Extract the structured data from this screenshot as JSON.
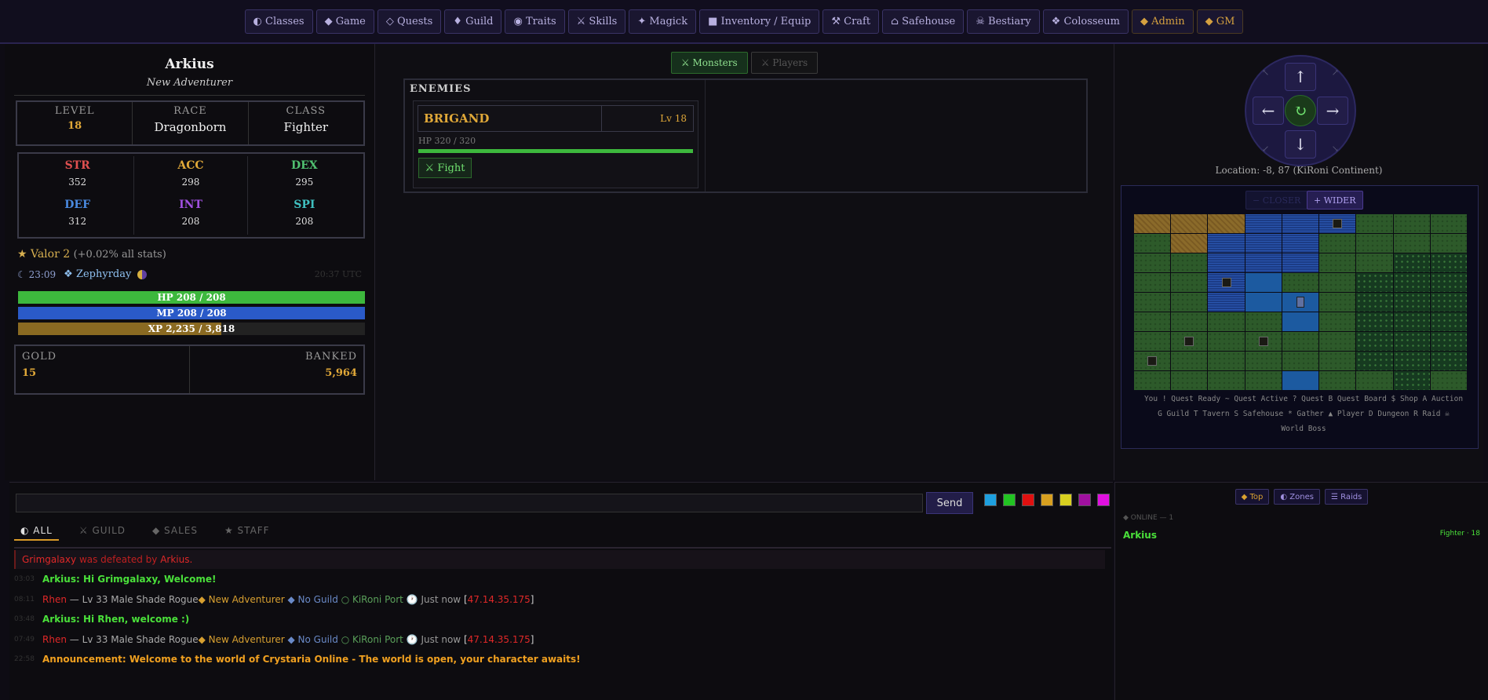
{
  "nav": {
    "items": [
      {
        "label": "◐ Classes",
        "color": "#b8b0e0"
      },
      {
        "label": "◆ Game",
        "color": "#b8b0e0"
      },
      {
        "label": "◇ Quests",
        "color": "#b8b0e0"
      },
      {
        "label": "♦ Guild",
        "color": "#b8b0e0"
      },
      {
        "label": "◉ Traits",
        "color": "#b8b0e0"
      },
      {
        "label": "⚔ Skills",
        "color": "#b8b0e0"
      },
      {
        "label": "✦ Magick",
        "color": "#b8b0e0"
      },
      {
        "label": "■ Inventory / Equip",
        "color": "#b8b0e0"
      },
      {
        "label": "⚒ Craft",
        "color": "#b8b0e0"
      },
      {
        "label": "⌂ Safehouse",
        "color": "#b8b0e0"
      },
      {
        "label": "☠ Bestiary",
        "color": "#b8b0e0"
      },
      {
        "label": "❖ Colosseum",
        "color": "#b8b0e0"
      },
      {
        "label": "◆ Admin",
        "color": "#d4a040"
      },
      {
        "label": "◆ GM",
        "color": "#d4a040"
      }
    ]
  },
  "character": {
    "name": "Arkius",
    "title": "New Adventurer",
    "level_label": "LEVEL",
    "level": "18",
    "race_label": "RACE",
    "race": "Dragonborn",
    "class_label": "CLASS",
    "class": "Fighter"
  },
  "stats": [
    {
      "name": "STR",
      "value": "352",
      "color": "#e05050"
    },
    {
      "name": "ACC",
      "value": "298",
      "color": "#e0a838"
    },
    {
      "name": "DEX",
      "value": "295",
      "color": "#50c070"
    },
    {
      "name": "DEF",
      "value": "312",
      "color": "#4a8ae0"
    },
    {
      "name": "INT",
      "value": "208",
      "color": "#a050e0"
    },
    {
      "name": "SPI",
      "value": "208",
      "color": "#40c0c0"
    }
  ],
  "valor": {
    "label": "★ Valor 2",
    "detail": "(+0.02% all stats)"
  },
  "time": {
    "game_time": "☾ 23:09",
    "day": "❖ Zephyrday",
    "utc": "20:37 UTC"
  },
  "bars": {
    "hp": {
      "text": "HP 208 / 208",
      "fraction": 1.0,
      "color": "#3db83d"
    },
    "mp": {
      "text": "MP 208 / 208",
      "fraction": 1.0,
      "color": "#2a5ac8"
    },
    "xp": {
      "text": "XP 2,235 / 3,818",
      "fraction": 0.585,
      "color": "#8a6a22"
    }
  },
  "gold": {
    "gold_label": "GOLD",
    "gold_value": "15",
    "banked_label": "BANKED",
    "banked_value": "5,964"
  },
  "combat": {
    "tab_monsters": "⚔ Monsters",
    "tab_players": "⚔ Players",
    "enemies_title": "ENEMIES",
    "enemy": {
      "name": "BRIGAND",
      "level": "Lv 18",
      "hp_text": "HP 320 / 320",
      "hp_fraction": 1.0,
      "fight_label": "⚔ Fight"
    }
  },
  "nav_pad": {
    "up": "↑",
    "down": "↓",
    "left": "←",
    "right": "→",
    "center": "↻",
    "ul": "↖",
    "ur": "↗",
    "dl": "↙",
    "dr": "↘"
  },
  "location": "Location: -8, 87 (KiRoni Continent)",
  "map": {
    "closer_label": "− CLOSER",
    "wider_label": "+ WIDER",
    "rows": [
      [
        "s",
        "s",
        "s",
        "w",
        "w",
        "w",
        "g",
        "g",
        "g"
      ],
      [
        "g",
        "s",
        "w",
        "w",
        "w",
        "g",
        "g",
        "g",
        "g"
      ],
      [
        "g",
        "g",
        "w",
        "w",
        "w",
        "g",
        "g",
        "f",
        "f"
      ],
      [
        "g",
        "g",
        "w",
        "d",
        "g",
        "g",
        "f",
        "f",
        "f"
      ],
      [
        "g",
        "g",
        "w",
        "d",
        "d",
        "g",
        "f",
        "f",
        "f"
      ],
      [
        "g",
        "g",
        "g",
        "g",
        "d",
        "g",
        "f",
        "f",
        "f"
      ],
      [
        "g",
        "g",
        "g",
        "g",
        "g",
        "g",
        "f",
        "f",
        "f"
      ],
      [
        "g",
        "g",
        "g",
        "g",
        "g",
        "g",
        "f",
        "f",
        "f"
      ],
      [
        "g",
        "g",
        "g",
        "g",
        "d",
        "g",
        "g",
        "f",
        "g"
      ]
    ],
    "legend_line1": "You ! Quest Ready ~ Quest Active ? Quest B Quest Board $ Shop A Auction",
    "legend_line2": "G Guild T Tavern S Safehouse * Gather ▲ Player D Dungeon R Raid ☠",
    "legend_line3": "World Boss"
  },
  "chat": {
    "input_placeholder": "",
    "send_label": "Send",
    "colors": [
      "#1ea0e0",
      "#22c422",
      "#e01010",
      "#d8a020",
      "#d8d020",
      "#a010a0",
      "#e010e0"
    ],
    "tabs": [
      "◐ ALL",
      "⚔ GUILD",
      "◆ SALES",
      "★ STAFF"
    ],
    "system": "Grimgalaxy was defeated by Arkius.",
    "lines": [
      {
        "time": "03:03",
        "text": "Arkius: Hi Grimgalaxy, Welcome!"
      },
      {
        "time": "08:11",
        "name": "Rhen",
        "detail": "— Lv 33 Male Shade Rogue",
        "title": "◆ New Adventurer",
        "guild": "◆ No Guild",
        "place": "○ KiRoni Port",
        "when": "🕐 Just now",
        "ip": "47.14.35.175"
      },
      {
        "time": "03:48",
        "text": "Arkius: Hi Rhen, welcome :)"
      },
      {
        "time": "07:49",
        "name": "Rhen",
        "detail": "— Lv 33 Male Shade Rogue",
        "title": "◆ New Adventurer",
        "guild": "◆ No Guild",
        "place": "○ KiRoni Port",
        "when": "🕐 Just now",
        "ip": "47.14.35.175"
      },
      {
        "time": "22:58",
        "text": "Announcement: Welcome to the world of Crystaria Online - The world is open, your character awaits!"
      }
    ]
  },
  "online": {
    "buttons": [
      "◆ Top",
      "◐ Zones",
      "☰ Raids"
    ],
    "header": "◆ ONLINE — 1",
    "players": [
      {
        "name": "Arkius",
        "info": "Fighter · 18"
      }
    ]
  }
}
